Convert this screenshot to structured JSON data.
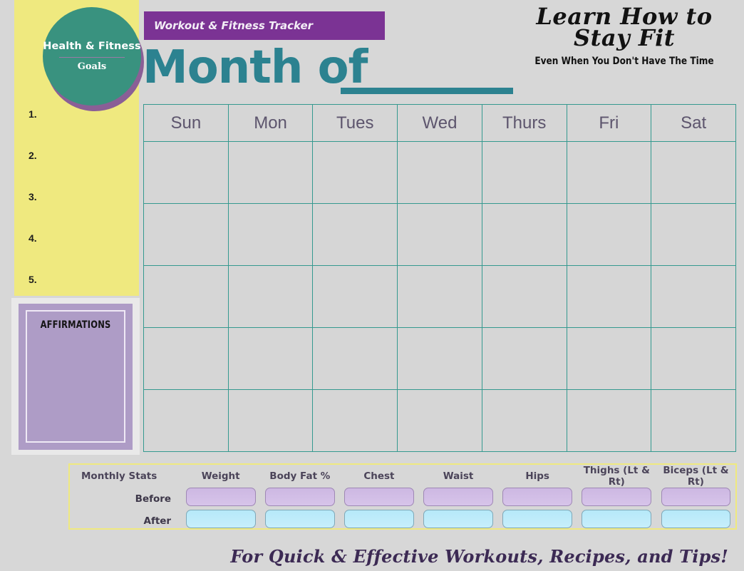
{
  "colors": {
    "background": "#d7d7d7",
    "teal": "#2c8290",
    "grid_teal": "#35998f",
    "badge_teal": "#39927f",
    "purple_banner": "#7b3394",
    "purple_soft": "#ae9cc6",
    "yellow": "#efe97f",
    "day_label": "#5d556d",
    "pill_before": "#cdb8e2",
    "pill_after": "#b6e9f9"
  },
  "goals_panel": {
    "badge_title": "Health & Fitness",
    "badge_subtitle": "Goals",
    "items": [
      "1.",
      "2.",
      "3.",
      "4.",
      "5."
    ]
  },
  "affirmations": {
    "title": "AFFIRMATIONS"
  },
  "header": {
    "tracker_banner": "Workout & Fitness Tracker",
    "month_title": "Month of",
    "month_value": ""
  },
  "brand": {
    "line1": "Learn How to",
    "line2": "Stay Fit",
    "subtitle": "Even When You Don't Have The Time"
  },
  "calendar": {
    "day_headers": [
      "Sun",
      "Mon",
      "Tues",
      "Wed",
      "Thurs",
      "Fri",
      "Sat"
    ],
    "week_count": 5
  },
  "stats": {
    "row_label_header": "Monthly Stats",
    "columns": [
      "Weight",
      "Body Fat %",
      "Chest",
      "Waist",
      "Hips",
      "Thighs (Lt & Rt)",
      "Biceps (Lt & Rt)"
    ],
    "rows": [
      {
        "label": "Before",
        "style": "before",
        "values": [
          "",
          "",
          "",
          "",
          "",
          "",
          ""
        ]
      },
      {
        "label": "After",
        "style": "after",
        "values": [
          "",
          "",
          "",
          "",
          "",
          "",
          ""
        ]
      }
    ]
  },
  "footer": {
    "tagline": "For Quick & Effective Workouts, Recipes, and Tips!"
  }
}
